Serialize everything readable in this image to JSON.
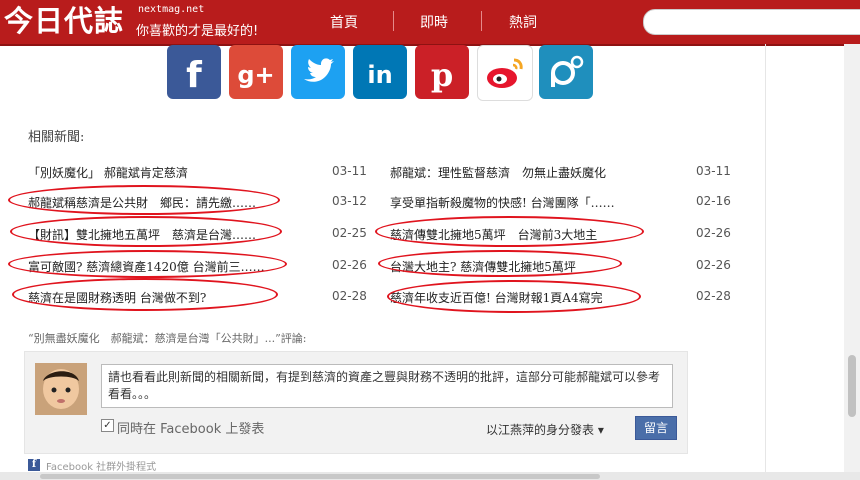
{
  "header": {
    "logo": "今日代誌",
    "site": "nextmag.net",
    "slogan": "你喜歡的才是最好的!",
    "nav": [
      "首頁",
      "即時",
      "熱詞"
    ]
  },
  "share": {
    "icons": [
      "facebook-icon",
      "google-plus-icon",
      "twitter-icon",
      "linkedin-icon",
      "pinterest-icon",
      "weibo-icon",
      "plurk-icon"
    ],
    "colors": {
      "facebook": "#3b5998",
      "google_plus": "#dd4b39",
      "twitter": "#1da1f2",
      "linkedin": "#0077b5",
      "pinterest": "#cb2027",
      "weibo": "#ffffff",
      "plurk": "#1f8fbd"
    }
  },
  "related": {
    "heading": "相關新聞:",
    "left": [
      {
        "title": "「別妖魔化」 郝龍斌肯定慈濟",
        "date": "03-11"
      },
      {
        "title": "郝龍斌稱慈濟是公共財　鄉民：請先繳……",
        "date": "03-12"
      },
      {
        "title": "【財訊】雙北擁地五萬坪　慈濟是台灣……",
        "date": "02-25"
      },
      {
        "title": "富可敵國? 慈濟總資產1420億 台灣前三……",
        "date": "02-26"
      },
      {
        "title": "慈濟在是國財務透明 台灣做不到?",
        "date": "02-28"
      }
    ],
    "right": [
      {
        "title": "郝龍斌：理性監督慈濟　勿無止盡妖魔化",
        "date": "03-11"
      },
      {
        "title": "享受單指斬殺魔物的快感! 台灣團隊「……",
        "date": "02-16"
      },
      {
        "title": "慈濟傳雙北擁地5萬坪　台灣前3大地主",
        "date": "02-26"
      },
      {
        "title": "台灣大地主? 慈濟傳雙北擁地5萬坪",
        "date": "02-26"
      },
      {
        "title": "慈濟年收支近百億! 台灣財報1頁A4寫完",
        "date": "02-28"
      }
    ]
  },
  "comments": {
    "quote": "“別無盡妖魔化　郝龍斌：慈濟是台灣「公共財」...”評論:",
    "text": "請也看看此則新聞的相關新聞，有提到慈濟的資產之豐與財務不透明的批評，這部分可能郝龍斌可以參考看看。。。",
    "post_to_facebook": "同時在 Facebook 上發表",
    "post_as": "以江燕萍的身分發表 ▾",
    "submit": "留言",
    "plugin": "Facebook 社群外掛程式"
  }
}
